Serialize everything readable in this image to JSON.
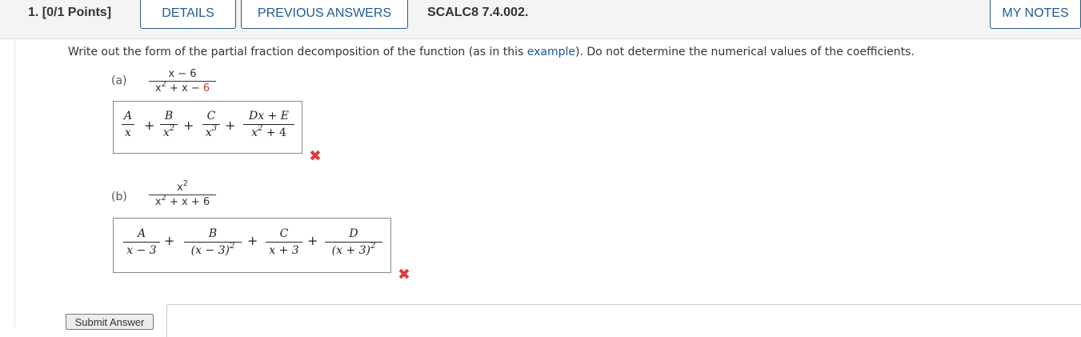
{
  "header": {
    "points_label": "1.  [0/1 Points]",
    "details_label": "DETAILS",
    "previous_answers_label": "PREVIOUS ANSWERS",
    "question_code": "SCALC8 7.4.002.",
    "my_notes_label": "MY NOTES"
  },
  "instructions": {
    "before_link": "Write out the form of the partial fraction decomposition of the function (as in this ",
    "link_text": "example",
    "after_link": "). Do not determine the numerical values of the coefficients."
  },
  "part_a": {
    "label": "(a)",
    "function_numerator": "x − 6",
    "function_denominator_parts": [
      "x",
      "2",
      " + x − ",
      "6"
    ],
    "answer_terms": [
      {
        "num": "A",
        "den": "x",
        "den_exp": ""
      },
      {
        "num": "B",
        "den": "x",
        "den_exp": "2"
      },
      {
        "num": "C",
        "den": "x",
        "den_exp": "3"
      },
      {
        "num": "Dx + E",
        "den": "x",
        "den_exp": "2",
        "den_suffix": " + 4"
      }
    ],
    "result_icon": "incorrect-x-icon"
  },
  "part_b": {
    "label": "(b)",
    "function_numerator": "x",
    "function_numerator_exp": "2",
    "function_denominator_parts": [
      "x",
      "2",
      " + x + 6"
    ],
    "answer_terms": [
      {
        "num": "A",
        "den": "x − 3",
        "den_exp": ""
      },
      {
        "num": "B",
        "den": "(x − 3)",
        "den_exp": "2"
      },
      {
        "num": "C",
        "den": "x + 3",
        "den_exp": ""
      },
      {
        "num": "D",
        "den": "(x + 3)",
        "den_exp": "2"
      }
    ],
    "result_icon": "incorrect-x-icon"
  },
  "plus_sign": "+",
  "submit_label": "Submit Answer",
  "colors": {
    "accent": "#1f5a98",
    "incorrect": "#e03b3b",
    "highlight_red": "#c0392b"
  }
}
